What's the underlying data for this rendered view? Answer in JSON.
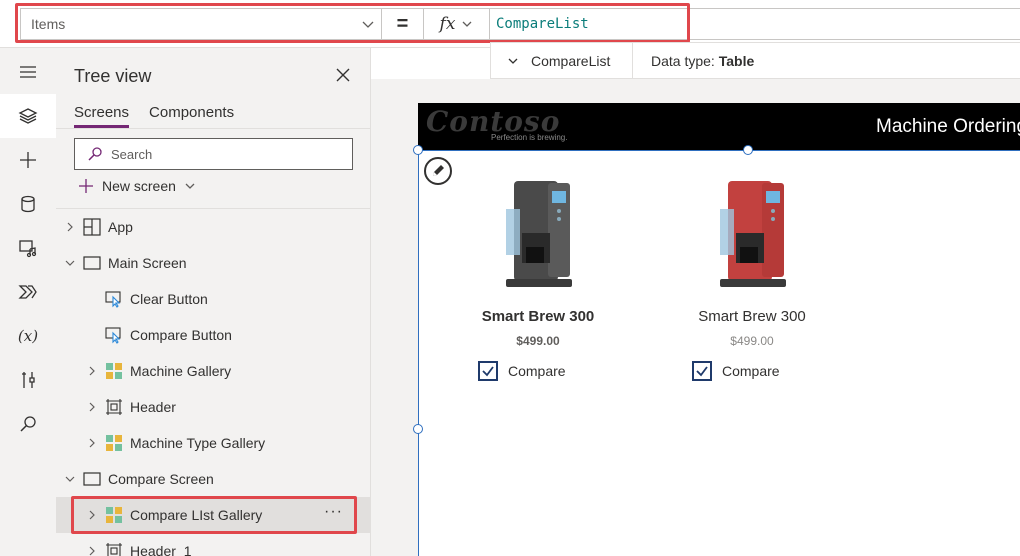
{
  "formula_bar": {
    "property": "Items",
    "equals": "=",
    "fx": "fx",
    "formula": "CompareList"
  },
  "sub_bar": {
    "expander_label": "CompareList",
    "data_type_label": "Data type:",
    "data_type_value": "Table"
  },
  "rail": {
    "icons": [
      "hamburger-icon",
      "layers-icon",
      "plus-icon",
      "database-icon",
      "media-icon",
      "power-automate-icon",
      "variables-icon",
      "tools-icon",
      "search-icon"
    ],
    "variables_label": "(x)"
  },
  "tree": {
    "title": "Tree view",
    "tabs": [
      "Screens",
      "Components"
    ],
    "active_tab": "Screens",
    "search_placeholder": "Search",
    "new_screen": "New screen",
    "rows": [
      {
        "label": "App",
        "icon": "app-icon"
      },
      {
        "label": "Main Screen",
        "icon": "screen-icon"
      },
      {
        "label": "Clear Button",
        "icon": "button-icon"
      },
      {
        "label": "Compare Button",
        "icon": "button-icon"
      },
      {
        "label": "Machine Gallery",
        "icon": "gallery-icon"
      },
      {
        "label": "Header",
        "icon": "group-icon"
      },
      {
        "label": "Machine Type Gallery",
        "icon": "gallery-icon"
      },
      {
        "label": "Compare Screen",
        "icon": "screen-icon"
      },
      {
        "label": "Compare LIst Gallery",
        "icon": "gallery-icon",
        "selected": true
      },
      {
        "label": "Header_1",
        "icon": "group-icon"
      }
    ],
    "more": "···"
  },
  "app": {
    "logo": "Contoso",
    "tagline": "Perfection is brewing.",
    "title": "Machine Ordering",
    "compare_label": "Compare",
    "items": [
      {
        "name": "Smart Brew 300",
        "price": "$499.00",
        "color": "#4a4a4a",
        "checked": true
      },
      {
        "name": "Smart Brew 300",
        "price": "$499.00",
        "color": "#c2413f",
        "checked": true
      }
    ]
  },
  "colors": {
    "highlight": "#e0474c",
    "selection": "#2f6fbf",
    "accent": "#742774"
  }
}
